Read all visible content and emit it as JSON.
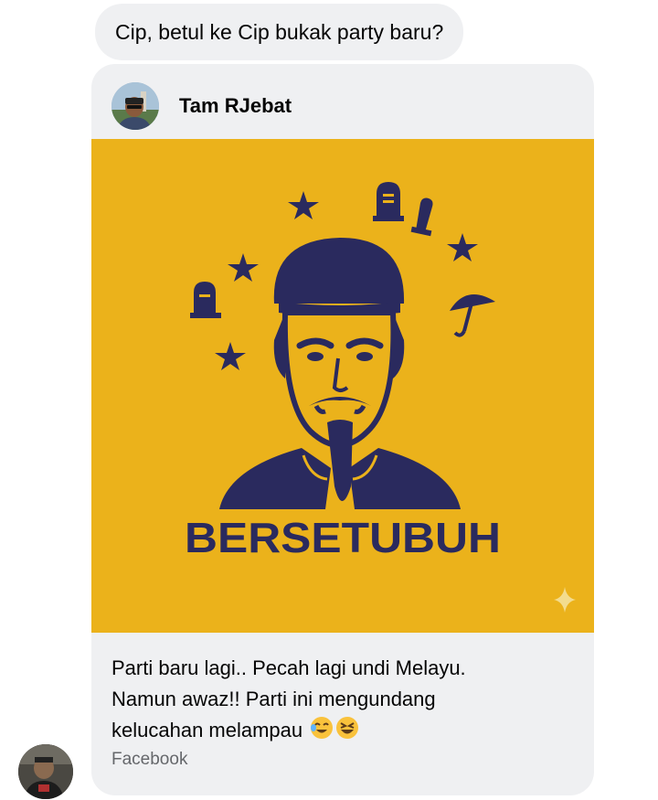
{
  "message": {
    "text": "Cip, betul ke Cip bukak party baru?"
  },
  "shared_post": {
    "author_name": "Tam RJebat",
    "image": {
      "headline": "BERSETUBUH",
      "background_color": "#ebb21b",
      "ink_color": "#2a2a5e"
    },
    "caption_lines": [
      "Parti baru lagi.. Pecah lagi undi Melayu.",
      "Namun awaz!! Parti ini mengundang",
      "kelucahan melampau"
    ],
    "caption_emojis": [
      "laughing-tears-emoji",
      "grinning-squint-emoji"
    ],
    "source": "Facebook"
  },
  "colors": {
    "bubble_bg": "#eff0f2",
    "text": "#050505",
    "secondary_text": "#65676b"
  }
}
